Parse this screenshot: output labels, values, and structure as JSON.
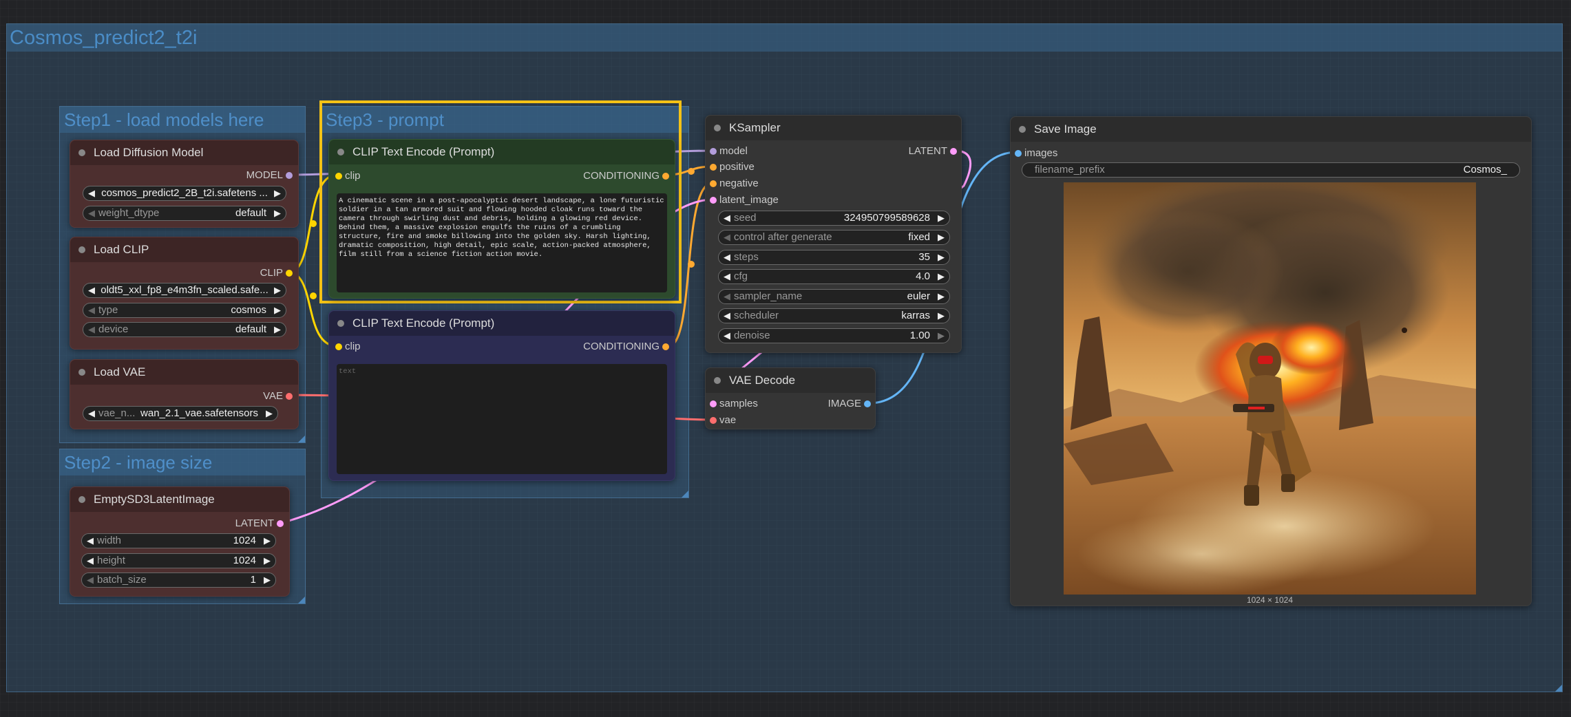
{
  "groups": {
    "outer": "Cosmos_predict2_t2i",
    "step1": "Step1 - load models here",
    "step2": "Step2 - image size",
    "step3": "Step3 - prompt"
  },
  "nodes": {
    "load_diffusion": {
      "title": "Load Diffusion Model",
      "output": "MODEL",
      "unet_name": "cosmos_predict2_2B_t2i.safetens ...",
      "weight_dtype_label": "weight_dtype",
      "weight_dtype": "default"
    },
    "load_clip": {
      "title": "Load CLIP",
      "output": "CLIP",
      "clip_name": "oldt5_xxl_fp8_e4m3fn_scaled.safe...",
      "type_label": "type",
      "type": "cosmos",
      "device_label": "device",
      "device": "default"
    },
    "load_vae": {
      "title": "Load VAE",
      "output": "VAE",
      "vae_label": "vae_n...",
      "vae_name": "wan_2.1_vae.safetensors"
    },
    "empty_latent": {
      "title": "EmptySD3LatentImage",
      "output": "LATENT",
      "width_label": "width",
      "width": "1024",
      "height_label": "height",
      "height": "1024",
      "batch_label": "batch_size",
      "batch_size": "1"
    },
    "clip_positive": {
      "title": "CLIP Text Encode (Prompt)",
      "input": "clip",
      "output": "CONDITIONING",
      "text": "A cinematic scene in a post-apocalyptic desert landscape, a lone futuristic soldier in a tan armored suit and flowing hooded cloak runs toward the camera through swirling dust and debris, holding a glowing red device. Behind them, a massive explosion engulfs the ruins of a crumbling structure, fire and smoke billowing into the golden sky. Harsh lighting, dramatic composition, high detail, epic scale, action-packed atmosphere, film still from a science fiction action movie."
    },
    "clip_negative": {
      "title": "CLIP Text Encode (Prompt)",
      "input": "clip",
      "output": "CONDITIONING",
      "placeholder": "text"
    },
    "ksampler": {
      "title": "KSampler",
      "inputs": [
        "model",
        "positive",
        "negative",
        "latent_image"
      ],
      "output": "LATENT",
      "seed_label": "seed",
      "seed": "324950799589628",
      "control_label": "control after generate",
      "control": "fixed",
      "steps_label": "steps",
      "steps": "35",
      "cfg_label": "cfg",
      "cfg": "4.0",
      "sampler_label": "sampler_name",
      "sampler_name": "euler",
      "scheduler_label": "scheduler",
      "scheduler": "karras",
      "denoise_label": "denoise",
      "denoise": "1.00"
    },
    "vae_decode": {
      "title": "VAE Decode",
      "inputs": [
        "samples",
        "vae"
      ],
      "output": "IMAGE"
    },
    "save_image": {
      "title": "Save Image",
      "input": "images",
      "prefix_label": "filename_prefix",
      "prefix": "Cosmos_",
      "caption": "1024 × 1024"
    }
  },
  "colors": {
    "model": "#b39ddb",
    "clip": "#ffd500",
    "conditioning": "#ffa931",
    "latent": "#ff9cf9",
    "vae": "#ff6e6e",
    "image": "#64b5f6",
    "selection": "#f4c216"
  },
  "preview_image": "desert-soldier-explosion-image"
}
